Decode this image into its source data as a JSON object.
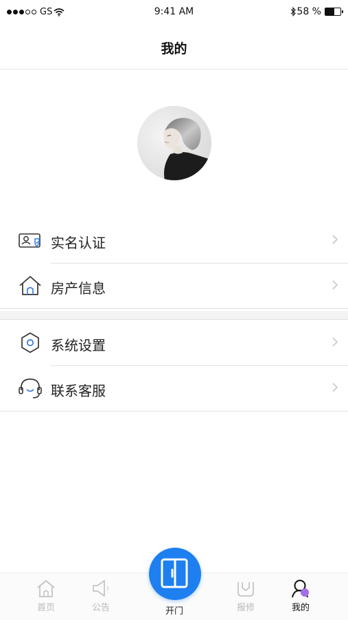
{
  "status_bar": {
    "carrier": "GS",
    "time": "9:41 AM",
    "battery": "58 %",
    "battery_level": 0.58
  },
  "header": {
    "title": "我的"
  },
  "profile": {
    "avatar": "avatar-icon"
  },
  "menu": {
    "group1": [
      {
        "label": "实名认证",
        "icon": "id-card-icon"
      },
      {
        "label": "房产信息",
        "icon": "house-icon"
      }
    ],
    "group2": [
      {
        "label": "系统设置",
        "icon": "settings-hexagon-icon"
      },
      {
        "label": "联系客服",
        "icon": "headset-icon"
      }
    ]
  },
  "tabbar": {
    "items": [
      {
        "label": "首页",
        "icon": "home-icon"
      },
      {
        "label": "公告",
        "icon": "megaphone-icon"
      },
      {
        "label": "开门",
        "icon": "door-icon"
      },
      {
        "label": "报修",
        "icon": "repair-icon"
      },
      {
        "label": "我的",
        "icon": "user-icon"
      }
    ],
    "active": "我的"
  },
  "colors": {
    "accent": "#1e7ff0",
    "icon_blue": "#3b7fe0",
    "active_badge": "#a56ee8",
    "inactive": "#b8b8b8"
  }
}
